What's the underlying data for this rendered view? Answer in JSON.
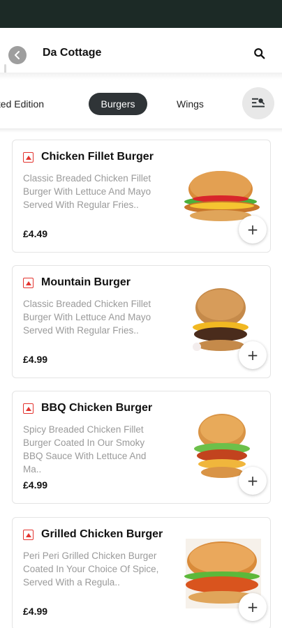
{
  "header": {
    "title": "Da Cottage"
  },
  "categories": [
    {
      "label": "Limited Edition",
      "visible_label": "nited Edition",
      "selected": false
    },
    {
      "label": "Burgers",
      "selected": true
    },
    {
      "label": "Wings",
      "selected": false
    }
  ],
  "colors": {
    "accent_dark": "#2f3437",
    "status_bar": "#1c2a26",
    "item_icon": "#e3342f",
    "desc_text": "#9a9a9a"
  },
  "items": [
    {
      "name": "Chicken Fillet Burger",
      "description": "Classic Breaded Chicken Fillet Burger With Lettuce And Mayo Served With Regular Fries..",
      "price": "£4.49",
      "icon": "non-veg-icon"
    },
    {
      "name": "Mountain Burger",
      "description": "Classic Breaded Chicken Fillet Burger With Lettuce And Mayo Served With Regular Fries..",
      "price": "£4.99",
      "icon": "non-veg-icon"
    },
    {
      "name": "BBQ Chicken Burger",
      "description": "Spicy Breaded Chicken Fillet Burger Coated In Our Smoky BBQ Sauce With Lettuce And Ma..",
      "price": "£4.99",
      "icon": "non-veg-icon"
    },
    {
      "name": "Grilled Chicken Burger",
      "description": "Peri Peri Grilled Chicken Burger Coated In Your Choice Of Spice, Served With a Regula..",
      "price": "£4.99",
      "icon": "non-veg-icon"
    }
  ],
  "add_label": "+"
}
